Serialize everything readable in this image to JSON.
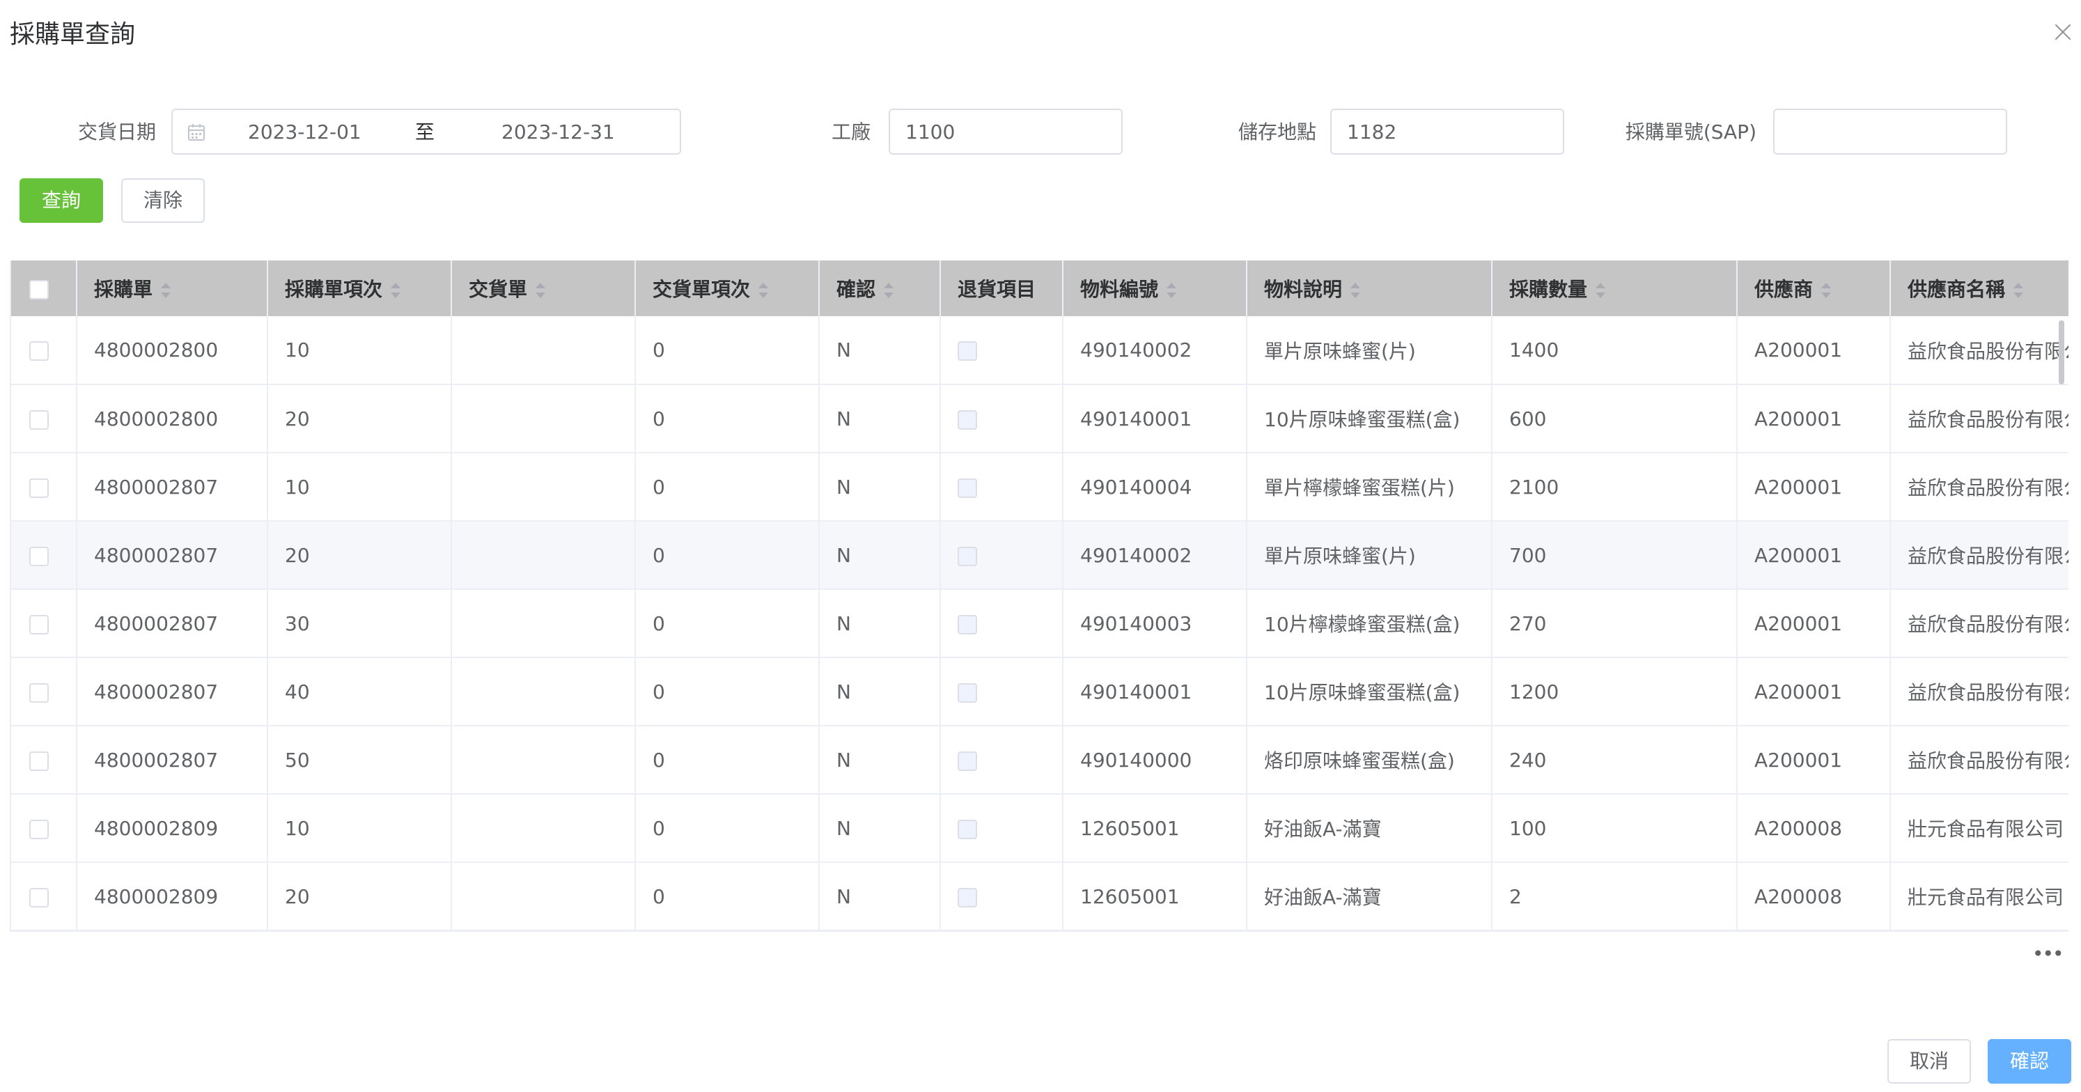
{
  "dialog": {
    "title": "採購單查詢"
  },
  "filters": {
    "delivery_date_label": "交貨日期",
    "date_start": "2023-12-01",
    "date_separator": "至",
    "date_end": "2023-12-31",
    "plant_label": "工廠",
    "plant_value": "1100",
    "storage_label": "儲存地點",
    "storage_value": "1182",
    "po_sap_label": "採購單號(SAP)",
    "po_sap_value": ""
  },
  "actions": {
    "query_label": "查詢",
    "clear_label": "清除"
  },
  "table": {
    "columns": [
      "採購單",
      "採購單項次",
      "交貨單",
      "交貨單項次",
      "確認",
      "退貨項目",
      "物料編號",
      "物料說明",
      "採購數量",
      "供應商",
      "供應商名稱"
    ],
    "rows": [
      [
        "4800002800",
        "10",
        "",
        "0",
        "N",
        "",
        "490140002",
        "單片原味蜂蜜(片)",
        "1400",
        "A200001",
        "益欣食品股份有限公司"
      ],
      [
        "4800002800",
        "20",
        "",
        "0",
        "N",
        "",
        "490140001",
        "10片原味蜂蜜蛋糕(盒)",
        "600",
        "A200001",
        "益欣食品股份有限公司"
      ],
      [
        "4800002807",
        "10",
        "",
        "0",
        "N",
        "",
        "490140004",
        "單片檸檬蜂蜜蛋糕(片)",
        "2100",
        "A200001",
        "益欣食品股份有限公司"
      ],
      [
        "4800002807",
        "20",
        "",
        "0",
        "N",
        "",
        "490140002",
        "單片原味蜂蜜(片)",
        "700",
        "A200001",
        "益欣食品股份有限公司"
      ],
      [
        "4800002807",
        "30",
        "",
        "0",
        "N",
        "",
        "490140003",
        "10片檸檬蜂蜜蛋糕(盒)",
        "270",
        "A200001",
        "益欣食品股份有限公司"
      ],
      [
        "4800002807",
        "40",
        "",
        "0",
        "N",
        "",
        "490140001",
        "10片原味蜂蜜蛋糕(盒)",
        "1200",
        "A200001",
        "益欣食品股份有限公司"
      ],
      [
        "4800002807",
        "50",
        "",
        "0",
        "N",
        "",
        "490140000",
        "烙印原味蜂蜜蛋糕(盒)",
        "240",
        "A200001",
        "益欣食品股份有限公司"
      ],
      [
        "4800002809",
        "10",
        "",
        "0",
        "N",
        "",
        "12605001",
        "好油飯A-滿寶",
        "100",
        "A200008",
        "壯元食品有限公司"
      ],
      [
        "4800002809",
        "20",
        "",
        "0",
        "N",
        "",
        "12605001",
        "好油飯A-滿寶",
        "2",
        "A200008",
        "壯元食品有限公司"
      ]
    ]
  },
  "pagination": {
    "more_label": "•••"
  },
  "footer": {
    "cancel_label": "取消",
    "confirm_label": "確認"
  }
}
